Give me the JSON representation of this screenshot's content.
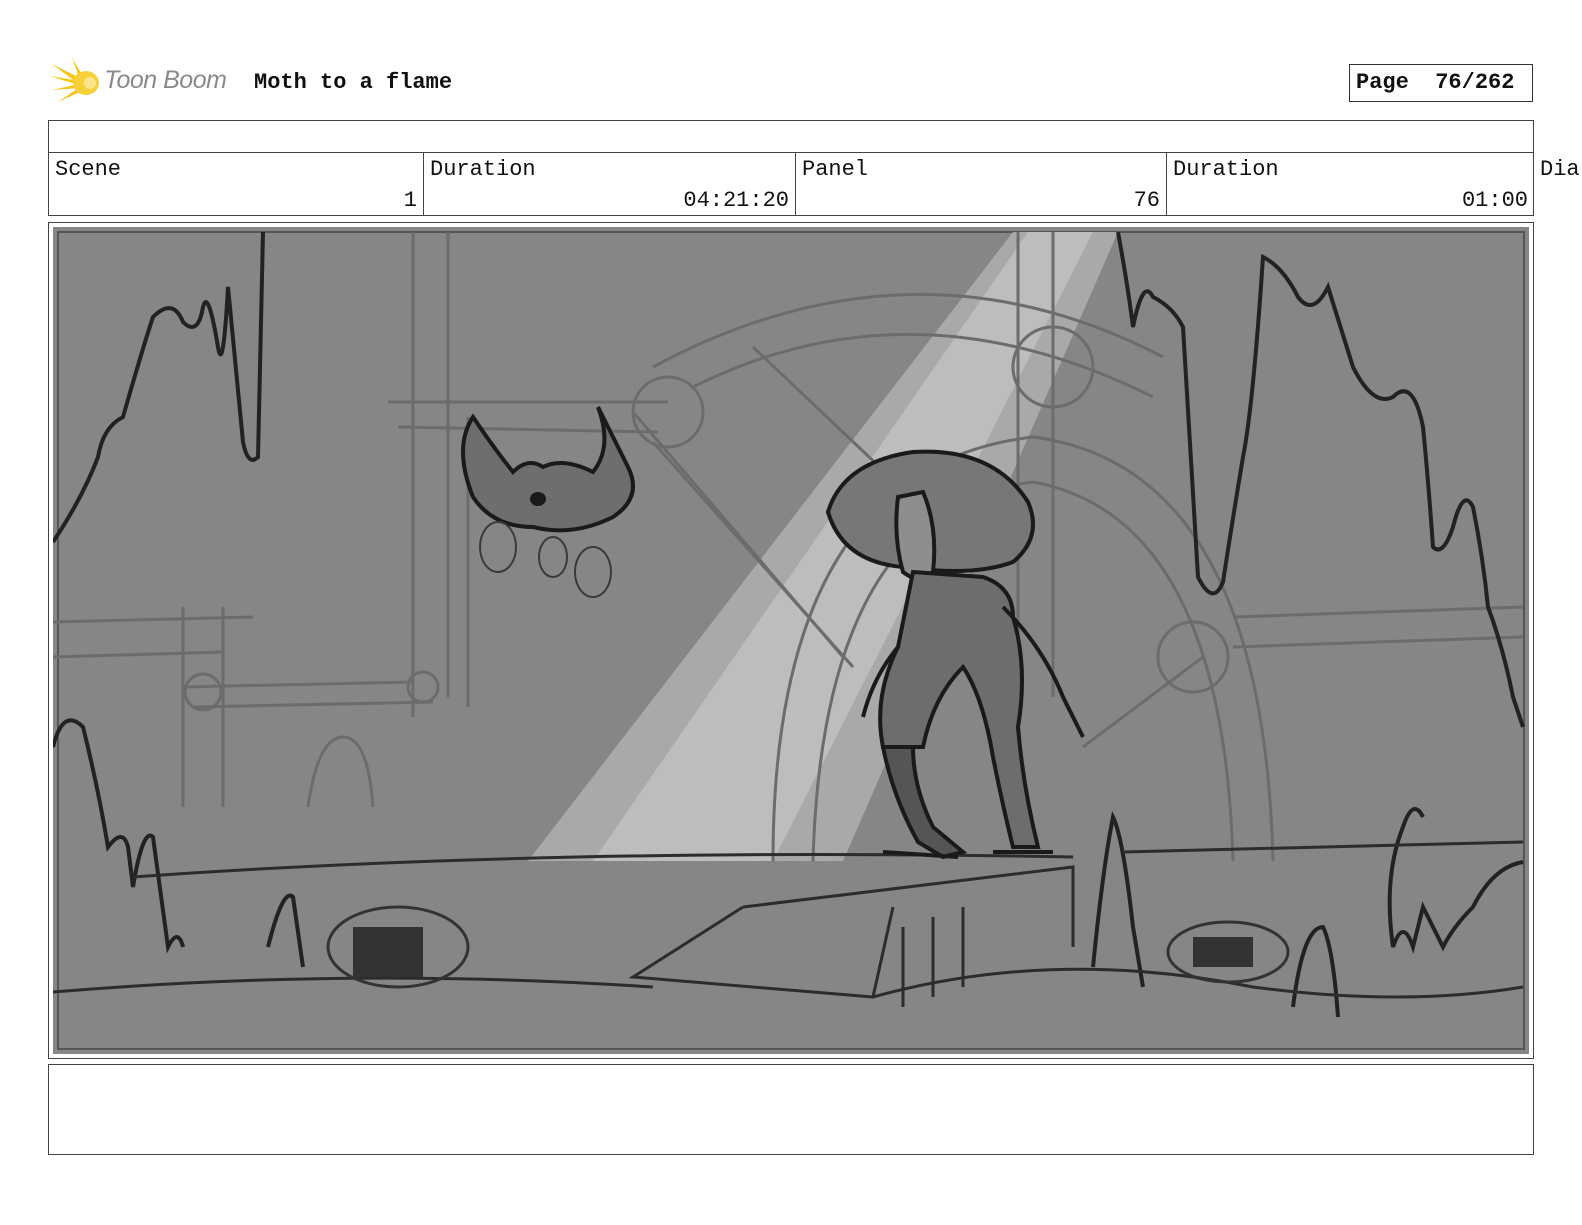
{
  "header": {
    "logo_text": "Toon Boom",
    "title": "Moth to a flame",
    "page_label": "Page",
    "page_value": "76/262"
  },
  "info": {
    "scene_label": "Scene",
    "scene_value": "1",
    "scene_duration_label": "Duration",
    "scene_duration_value": "04:21:20",
    "panel_label": "Panel",
    "panel_value": "76",
    "panel_duration_label": "Duration",
    "panel_duration_value": "01:00",
    "dialog_label_truncated": "Dia"
  },
  "colors": {
    "panel_bg": "#858585",
    "light_beam": "#b3b3b3",
    "line_dark": "#1e1e1e",
    "line_light": "#6a6a6a",
    "logo_yellow": "#f5c518"
  }
}
